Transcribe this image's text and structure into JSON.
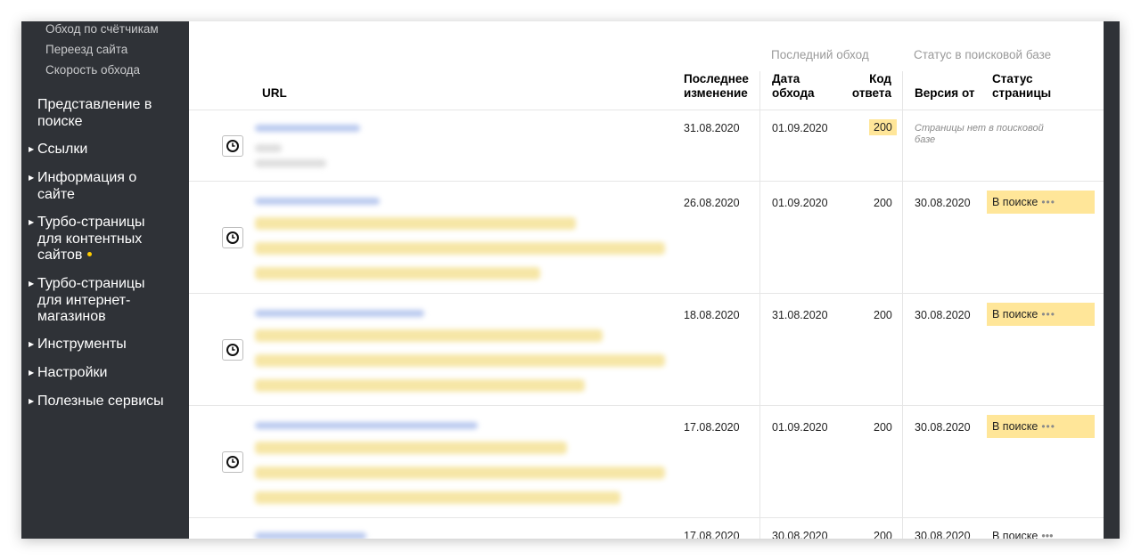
{
  "sidebar": {
    "sub_items": [
      "Обход по счётчикам",
      "Переезд сайта",
      "Скорость обхода"
    ],
    "section_title": "Представление в поиске",
    "nav_items": [
      {
        "label": "Ссылки"
      },
      {
        "label": "Информация о сайте"
      },
      {
        "label": "Турбо-страницы для контентных сайтов",
        "has_dot": true
      },
      {
        "label": "Турбо-страницы для интернет-магазинов"
      },
      {
        "label": "Инструменты"
      },
      {
        "label": "Настройки"
      },
      {
        "label": "Полезные сервисы"
      }
    ],
    "dot_color": "#ffcc00",
    "background": "#2f3237"
  },
  "table": {
    "group_headers": {
      "last_crawl": "Последний обход",
      "search_status": "Статус в поисковой базе"
    },
    "columns": {
      "url": "URL",
      "last_change": "Последнее изменение",
      "crawl_date": "Дата обхода",
      "response_code": "Код ответа",
      "version_from": "Версия от",
      "page_status": "Статус страницы"
    },
    "rows": [
      {
        "last_change": "31.08.2020",
        "crawl_date": "01.09.2020",
        "code": "200",
        "code_highlight": true,
        "version": "",
        "status": "",
        "note": "Страницы нет в поисковой базе"
      },
      {
        "last_change": "26.08.2020",
        "crawl_date": "01.09.2020",
        "code": "200",
        "version": "30.08.2020",
        "status": "В поиске",
        "more": "•••"
      },
      {
        "last_change": "18.08.2020",
        "crawl_date": "31.08.2020",
        "code": "200",
        "version": "30.08.2020",
        "status": "В поиске",
        "more": "•••"
      },
      {
        "last_change": "17.08.2020",
        "crawl_date": "01.09.2020",
        "code": "200",
        "version": "30.08.2020",
        "status": "В поиске",
        "more": "•••"
      },
      {
        "last_change": "17.08.2020",
        "crawl_date": "30.08.2020",
        "code": "200",
        "version": "30.08.2020",
        "status": "В поиске",
        "more": "•••"
      }
    ],
    "highlight_color": "#ffe699",
    "icon": "clock-icon"
  }
}
